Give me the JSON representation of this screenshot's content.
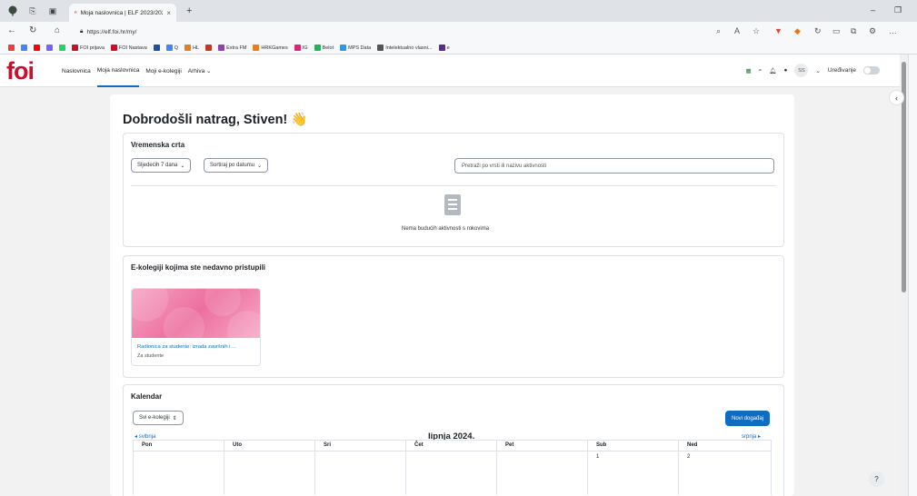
{
  "browser": {
    "tab_title": "Moja naslovnica | ELF 2023/2024",
    "tab_close": "×",
    "new_tab": "+",
    "url": "https://elf.foi.hr/my/",
    "bookmarks": [
      {
        "label": "",
        "color": "#ea4335"
      },
      {
        "label": "",
        "color": "#4285f4"
      },
      {
        "label": "",
        "color": "#ff0000"
      },
      {
        "label": "",
        "color": "#7b61ff"
      },
      {
        "label": "",
        "color": "#25d366"
      },
      {
        "label": "FOI prijava",
        "color": "#c8102e"
      },
      {
        "label": "FOI Nastava",
        "color": "#c8102e"
      },
      {
        "label": "",
        "color": "#1e4fa8"
      },
      {
        "label": "Q",
        "color": "#4285f4"
      },
      {
        "label": "HL",
        "color": "#e67e22"
      },
      {
        "label": "",
        "color": "#c0392b"
      },
      {
        "label": "Extra FM",
        "color": "#8e44ad"
      },
      {
        "label": "HRKGames",
        "color": "#e67e22"
      },
      {
        "label": "IG",
        "color": "#d62976"
      },
      {
        "label": "Belot",
        "color": "#27ae60"
      },
      {
        "label": "MPS Data",
        "color": "#3498db"
      },
      {
        "label": "Intelektualno vlasni...",
        "color": "#555555"
      },
      {
        "label": "e",
        "color": "#5b2c8f"
      }
    ]
  },
  "nav": {
    "logo": "foi",
    "items": [
      "Naslovnica",
      "Moja naslovnica",
      "Moji e-kolegiji",
      "Arhiva"
    ],
    "avatar": "SS",
    "edit_label": "Uređivanje"
  },
  "page": {
    "title": "Dobrodošli natrag, Stiven! 👋"
  },
  "timeline": {
    "title": "Vremenska crta",
    "filter_days": "Sljedećih 7 dana",
    "sort": "Sortiraj po datumu",
    "search_placeholder": "Pretraži po vrsti ili nazivu aktivnosti",
    "empty_text": "Nema budućih aktivnosti s rokovima"
  },
  "recent": {
    "title": "E-kolegiji kojima ste nedavno pristupili",
    "course_name": "Radionica za studente: izrada završnih i ...",
    "course_category": "Za studente"
  },
  "calendar": {
    "title": "Kalendar",
    "course_filter": "Svi e-kolegiji",
    "new_event": "Novi događaj",
    "prev": "svibnja",
    "next": "srpnja",
    "month": "lipnja 2024.",
    "days": [
      "Pon",
      "Uto",
      "Sri",
      "Čet",
      "Pet",
      "Sub",
      "Ned"
    ],
    "first_row": [
      "",
      "",
      "",
      "",
      "",
      "1",
      "2"
    ]
  },
  "help": "?"
}
